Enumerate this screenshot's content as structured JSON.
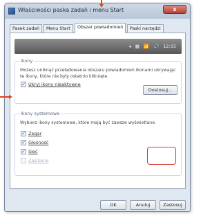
{
  "window": {
    "title": "Właściwości paska zadań i menu Start",
    "close_label": "x"
  },
  "tabs": [
    {
      "label": "Pasek zadań",
      "active": false
    },
    {
      "label": "Menu Start",
      "active": false
    },
    {
      "label": "Obszar powiadomień",
      "active": true
    },
    {
      "label": "Paski narzędzi",
      "active": false
    }
  ],
  "preview": {
    "tray_icons": [
      "◂",
      "▦",
      "📶",
      "🔊"
    ],
    "time": "12:55"
  },
  "icons_group": {
    "title": "Ikony",
    "description": "Możesz uniknąć przeładowania obszaru powiadomień ikonami ukrywając te ikony, które nie były ostatnio kliknięte.",
    "hide_inactive_label": "Ukryj ikony nieaktywne",
    "hide_inactive_checked": true,
    "customize_label": "Dostosuj..."
  },
  "system_icons_group": {
    "title": "Ikony systemowe",
    "description": "Wybierz ikony systemowe, które mają być zawsze wyświetlane.",
    "items": [
      {
        "label": "Zegar",
        "checked": true,
        "enabled": true
      },
      {
        "label": "Głośność",
        "checked": true,
        "enabled": true
      },
      {
        "label": "Sieć",
        "checked": true,
        "enabled": true
      },
      {
        "label": "Zasilanie",
        "checked": false,
        "enabled": false
      }
    ]
  },
  "buttons": {
    "ok": "OK",
    "cancel": "Anuluj",
    "apply": "Zastosuj"
  },
  "colors": {
    "annotation": "#e0441e",
    "highlight_box": "#d33a2c"
  }
}
